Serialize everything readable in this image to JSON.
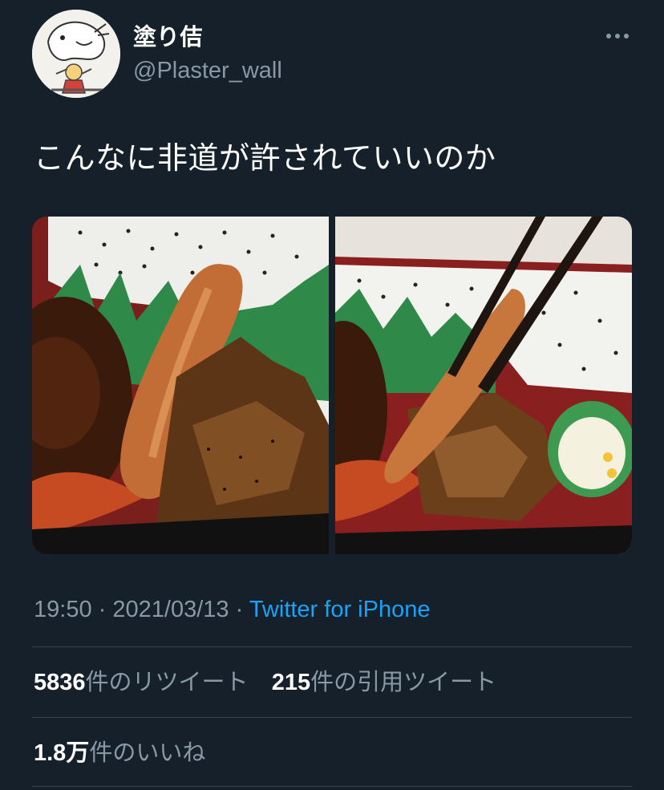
{
  "user": {
    "display_name": "塗り佶",
    "handle": "@Plaster_wall",
    "avatar_icon": "avatar-illustration",
    "more_icon": "more-horizontal-icon"
  },
  "tweet": {
    "text": "こんなに非道が許されていいのか",
    "photos": [
      {
        "description_icon": "bento-photo-1"
      },
      {
        "description_icon": "bento-photo-2"
      }
    ]
  },
  "meta": {
    "time": "19:50",
    "separator": "·",
    "date": "2021/03/13",
    "source": "Twitter for iPhone"
  },
  "stats": {
    "retweets_count": "5836",
    "retweets_label": "件のリツイート",
    "quotes_count": "215",
    "quotes_label": "件の引用ツイート",
    "likes_count": "1.8万",
    "likes_label": "件のいいね"
  },
  "colors": {
    "background": "#15202b",
    "secondary_text": "#8899a6",
    "link": "#1da1f2",
    "divider": "#38444d"
  }
}
